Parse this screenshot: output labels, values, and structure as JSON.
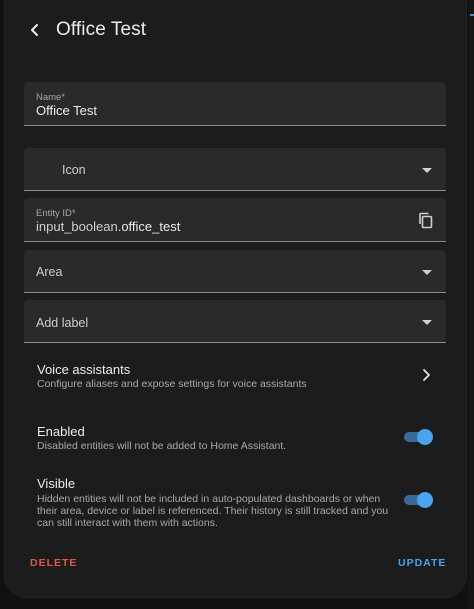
{
  "header": {
    "title": "Office Test"
  },
  "form": {
    "name": {
      "label": "Name*",
      "value": "Office Test"
    },
    "icon": {
      "placeholder": "Icon"
    },
    "entity_id": {
      "label": "Entity ID*",
      "prefix": "input_boolean.",
      "value": "office_test"
    },
    "area": {
      "placeholder": "Area"
    },
    "add_label": {
      "placeholder": "Add label"
    }
  },
  "voice_assistants": {
    "title": "Voice assistants",
    "subtitle": "Configure aliases and expose settings for voice assistants"
  },
  "enabled": {
    "title": "Enabled",
    "subtitle": "Disabled entities will not be added to Home Assistant.",
    "state": true
  },
  "visible": {
    "title": "Visible",
    "subtitle_lines": [
      "Hidden entities will not be included in auto-populated dashboards or when",
      "their area, device or label is referenced. Their history is still tracked and you",
      "can still interact with them with actions."
    ],
    "state": true
  },
  "actions": {
    "delete": "DELETE",
    "update": "UPDATE"
  },
  "colors": {
    "accent": "#4aa3ef",
    "danger": "#e0564d",
    "surface": "#1c1c1c",
    "field": "#2a2a2a"
  }
}
